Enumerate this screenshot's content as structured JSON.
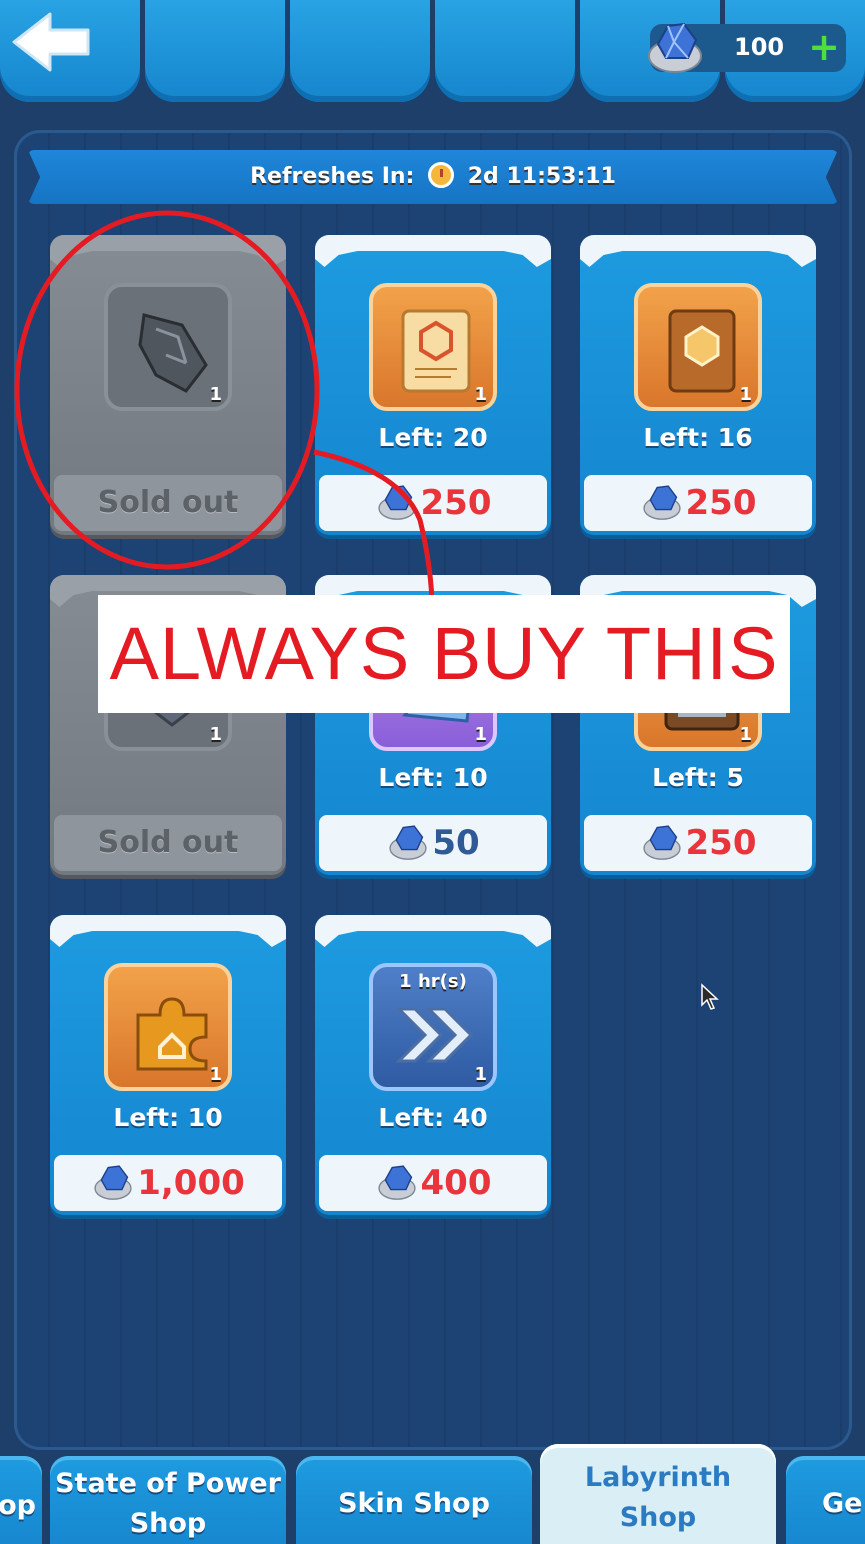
{
  "header": {
    "currency_amount": "100",
    "currency_icon": "gem-icon",
    "add_label": "+"
  },
  "banner": {
    "prefix": "Refreshes In:",
    "time": "2d 11:53:11"
  },
  "cards": [
    {
      "qty": "1",
      "status": "Sold out",
      "sold": true,
      "icon": "ore-icon"
    },
    {
      "qty": "1",
      "left": "Left: 20",
      "price": "250",
      "affordable": false,
      "icon": "scroll-icon"
    },
    {
      "qty": "1",
      "left": "Left: 16",
      "price": "250",
      "affordable": false,
      "icon": "book-icon"
    },
    {
      "qty": "1",
      "status": "Sold out",
      "sold": true,
      "icon": "crystal-icon"
    },
    {
      "qty": "1",
      "left": "Left: 10",
      "price": "50",
      "affordable": true,
      "icon": "ice-crystal-icon"
    },
    {
      "qty": "1",
      "left": "Left: 5",
      "price": "250",
      "affordable": false,
      "icon": "chest-icon"
    },
    {
      "qty": "1",
      "left": "Left: 10",
      "price": "1,000",
      "affordable": false,
      "icon": "puzzle-piece-icon"
    },
    {
      "qty": "1",
      "left": "Left: 40",
      "price": "400",
      "affordable": false,
      "icon": "speedup-icon",
      "duration": "1 hr(s)"
    }
  ],
  "annotation": {
    "text": "ALWAYS BUY THIS",
    "color": "#e51b23"
  },
  "tabs": [
    {
      "label": "op",
      "active": false
    },
    {
      "label": "State of Power Shop",
      "line1": "State of Power",
      "line2": "Shop",
      "active": false
    },
    {
      "label": "Skin Shop",
      "active": false
    },
    {
      "label": "Labyrinth Shop",
      "line1": "Labyrinth",
      "line2": "Shop",
      "active": true
    },
    {
      "label": "Ge",
      "active": false
    }
  ]
}
